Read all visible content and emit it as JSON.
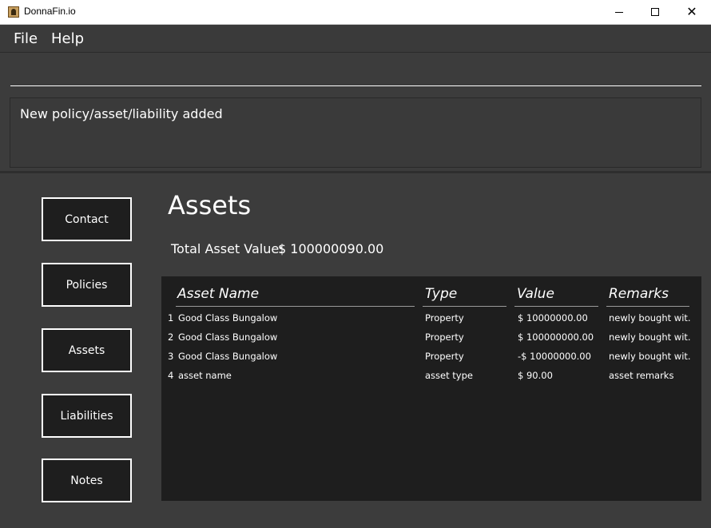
{
  "window": {
    "title": "DonnaFin.io"
  },
  "menu": {
    "file": "File",
    "help": "Help"
  },
  "command": {
    "value": "",
    "placeholder": ""
  },
  "result": {
    "message": "New policy/asset/liability added"
  },
  "nav": {
    "contact": "Contact",
    "policies": "Policies",
    "assets": "Assets",
    "liabilities": "Liabilities",
    "notes": "Notes"
  },
  "main": {
    "title": "Assets",
    "total_label": "Total Asset Value:",
    "total_value": "$ 100000090.00"
  },
  "table": {
    "columns": [
      "Asset Name",
      "Type",
      "Value",
      "Remarks"
    ],
    "rows": [
      {
        "index": "1",
        "name": "Good Class Bungalow",
        "type": "Property",
        "value": "$ 10000000.00",
        "remarks": "newly bought wit..."
      },
      {
        "index": "2",
        "name": "Good Class Bungalow",
        "type": "Property",
        "value": "$ 100000000.00",
        "remarks": "newly bought wit..."
      },
      {
        "index": "3",
        "name": "Good Class Bungalow",
        "type": "Property",
        "value": "-$ 10000000.00",
        "remarks": "newly bought wit..."
      },
      {
        "index": "4",
        "name": "asset name",
        "type": "asset type",
        "value": "$ 90.00",
        "remarks": "asset remarks"
      }
    ]
  }
}
